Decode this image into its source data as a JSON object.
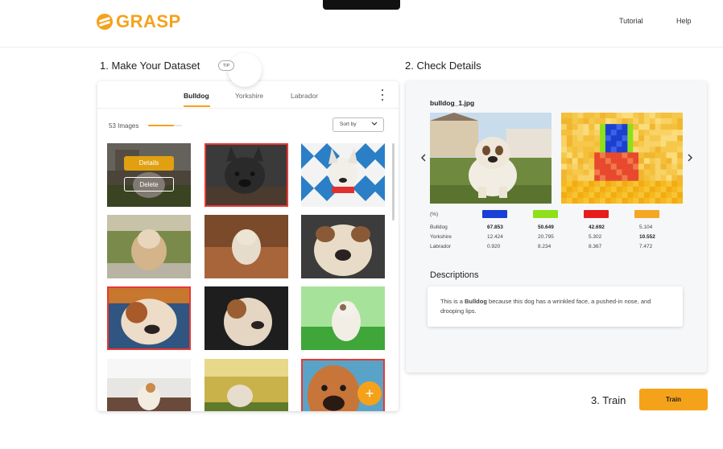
{
  "header": {
    "brand": "GRASP",
    "nav": [
      "Tutorial",
      "Help"
    ]
  },
  "dataset": {
    "title": "1. Make Your Dataset",
    "toggle_label": "TIP",
    "tabs": [
      "Bulldog",
      "Yorkshire",
      "Labrador"
    ],
    "active_tab": "Bulldog",
    "count_label": "53 Images",
    "progress_fraction": 0.75,
    "sort_label": "Sort by",
    "details_button": "Details",
    "delete_button": "Delete",
    "add_button": "+",
    "images": [
      {
        "selected": false,
        "scene": "house-bulldog"
      },
      {
        "selected": true,
        "scene": "frenchie-dark"
      },
      {
        "selected": false,
        "scene": "frenchie-tiles"
      },
      {
        "selected": false,
        "scene": "bulldog-hay"
      },
      {
        "selected": false,
        "scene": "bulldog-leaves"
      },
      {
        "selected": false,
        "scene": "bulldog-closeup"
      },
      {
        "selected": true,
        "scene": "bulldog-blue"
      },
      {
        "selected": false,
        "scene": "bulldog-dark"
      },
      {
        "selected": false,
        "scene": "bulldog-green"
      },
      {
        "selected": false,
        "scene": "bulldog-kitchen"
      },
      {
        "selected": false,
        "scene": "bulldog-field"
      },
      {
        "selected": true,
        "scene": "boxer-sky"
      }
    ]
  },
  "details": {
    "title": "2. Check Details",
    "filename": "bulldog_1.jpg",
    "table": {
      "unit_label": "(%)",
      "column_colors": [
        "#1a3fd4",
        "#8ee01a",
        "#e51d1d",
        "#f5a623"
      ],
      "rows": [
        {
          "label": "Bulldog",
          "values": [
            "67.853",
            "50.649",
            "42.692",
            "5.104"
          ],
          "bold": [
            0,
            1,
            2
          ]
        },
        {
          "label": "Yorkshire",
          "values": [
            "12.424",
            "20.795",
            "5.302",
            "10.552"
          ],
          "bold": [
            3
          ]
        },
        {
          "label": "Labrador",
          "values": [
            "0.920",
            "8.234",
            "8.367",
            "7.472"
          ],
          "bold": []
        }
      ]
    },
    "descriptions_heading": "Descriptions",
    "description_prefix": "This is a ",
    "description_class": "Bulldog",
    "description_suffix": " because this dog has a wrinkled face, a pushed-in nose, and drooping lips."
  },
  "train": {
    "title": "3. Train",
    "button": "Train"
  },
  "colors": {
    "accent": "#f5a21b",
    "selected_border": "#e53935"
  },
  "icons": [
    "grasp-logo-icon",
    "kebab-menu-icon",
    "chevron-down-icon",
    "chevron-left-icon",
    "chevron-right-icon",
    "plus-icon"
  ]
}
